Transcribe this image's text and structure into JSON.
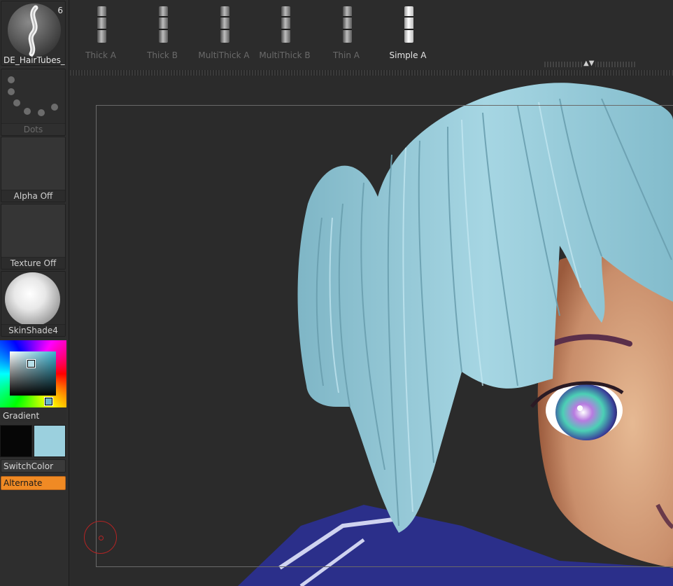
{
  "brush": {
    "name": "DE_HairTubes_v.",
    "count": "6"
  },
  "stroke": {
    "label": "Dots"
  },
  "alpha": {
    "label": "Alpha Off"
  },
  "texture": {
    "label": "Texture Off"
  },
  "material": {
    "label": "SkinShade4"
  },
  "color": {
    "gradient_label": "Gradient",
    "main_color": "#060606",
    "secondary_color": "#9bd0de",
    "switch_label": "SwitchColor",
    "alternate_label": "Alternate"
  },
  "brush_bar": {
    "items": [
      {
        "label": "Thick A",
        "active": false
      },
      {
        "label": "Thick B",
        "active": false
      },
      {
        "label": "MultiThick A",
        "active": false
      },
      {
        "label": "MultiThick B",
        "active": false
      },
      {
        "label": "Thin A",
        "active": false
      },
      {
        "label": "Simple A",
        "active": true
      }
    ]
  },
  "colors": {
    "accent": "#f08a24",
    "hair": "#8fc6d6",
    "skin": "#d9a37f",
    "cursor": "#b42424"
  },
  "icons": [
    "hair-brush-icon",
    "dots-stroke-icon",
    "material-sphere-icon",
    "tube-brush-icon",
    "scroll-arrows-icon",
    "draw-cursor-icon"
  ]
}
